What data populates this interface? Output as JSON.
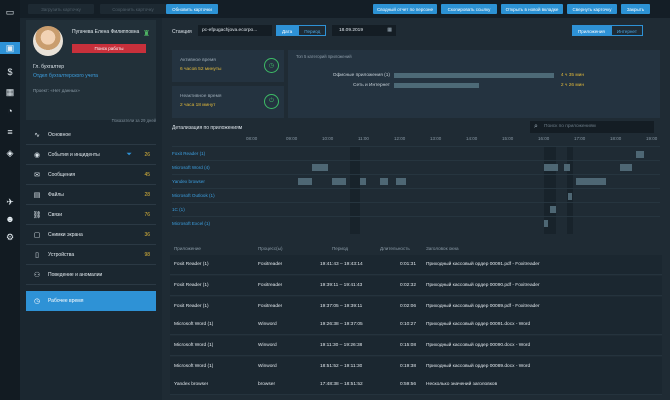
{
  "rail": {
    "icons": [
      "monitor-icon",
      "folder-icon",
      "dollar-icon",
      "calendar-icon",
      "chart-icon",
      "search-icon",
      "list-icon",
      "badge-icon",
      "airplane-icon",
      "person-icon",
      "filter-icon",
      "gear-icon"
    ]
  },
  "toolbar": {
    "ghost1": "Загрузить карточку",
    "ghost2": "Сохранить карточку",
    "update": "Обновить карточки",
    "summary_report": "Сводный отчет по персоне",
    "copy_link": "Скопировать ссылку",
    "open_new_tab": "Открыть в новой вкладке",
    "collapse_card": "Свернуть карточку",
    "close": "Закрыть"
  },
  "profile": {
    "name": "Пугачева Елена Филипповна",
    "search_button": "Поиск работы",
    "role": "Гл. бухгалтер",
    "department": "Отдел бухгалтерского учета",
    "project": "Проект: «Нет данных»",
    "period_label": "Показатели за 29 дней"
  },
  "menu": [
    {
      "label": "Основное",
      "count": ""
    },
    {
      "label": "События и инциденты",
      "count": "26"
    },
    {
      "label": "Сообщения",
      "count": "45"
    },
    {
      "label": "Файлы",
      "count": "28"
    },
    {
      "label": "Связи",
      "count": "76"
    },
    {
      "label": "Снимки экрана",
      "count": "36"
    },
    {
      "label": "Устройства",
      "count": "98"
    },
    {
      "label": "Поведение и аномалии",
      "count": ""
    },
    {
      "label": "Рабочее время",
      "count": ""
    }
  ],
  "main": {
    "station_label": "Станция",
    "station_value": "pc-efpugachjova.ecorpo...",
    "date_btn": "Дата",
    "period_btn": "Период",
    "date_value": "18.09.2019",
    "apps_btn": "Приложения",
    "internet_btn": "Интернет",
    "active_label": "Активное время",
    "active_value": "6 часов 52 минуты",
    "inactive_label": "Неактивное время",
    "inactive_value": "2 часа 18 минут",
    "categories_title": "Топ 5 категорий приложений",
    "categories": [
      {
        "label": "Офисные приложения (1)",
        "value": "4 ч 35 мин",
        "fraction": 1.0
      },
      {
        "label": "Сеть и Интернет",
        "value": "2 ч 26 мин",
        "fraction": 0.53
      }
    ],
    "detail_title": "Детализация по приложениям",
    "search_placeholder": "Поиск по приложениям"
  },
  "timeline": {
    "hours": [
      "08:00",
      "09:00",
      "10:00",
      "11:00",
      "12:00",
      "13:00",
      "14:00",
      "15:00",
      "16:00",
      "17:00",
      "18:00",
      "19:00"
    ],
    "apps": [
      "Foxit Reader (1)",
      "Microsoft Word (4)",
      "Yandex browser",
      "Microsoft Outlook (1)",
      "1C (1)",
      "Microsoft Excel (1)"
    ]
  },
  "table": {
    "headers": [
      "Приложение",
      "Процесс(ы)",
      "Период",
      "Длительность",
      "Заголовок окна"
    ],
    "rows": [
      [
        "Foxit Reader (1)",
        "Foxitreader",
        "19:41:43 – 19:43:14",
        "0:01:31",
        "Приходный кассовый ордер 00091.pdf - Foxitreader"
      ],
      [
        "Foxit Reader (1)",
        "Foxitreader",
        "19:39:11 – 19:41:43",
        "0:02:32",
        "Приходный кассовый ордер 00090.pdf - Foxitreader"
      ],
      [
        "Foxit Reader (1)",
        "Foxitreader",
        "19:37:05 – 19:39:11",
        "0:02:06",
        "Приходный кассовый ордер 00089.pdf - Foxitreader"
      ],
      [
        "Microsoft Word (1)",
        "Winword",
        "19:26:38 – 19:37:05",
        "0:10:27",
        "Приходный кассовый ордер 00091.docx - Word"
      ],
      [
        "Microsoft Word (1)",
        "Winword",
        "19:11:30 – 19:26:38",
        "0:15:08",
        "Приходный кассовый ордер 00090.docx - Word"
      ],
      [
        "Microsoft Word (1)",
        "Winword",
        "18:51:52 – 19:11:30",
        "0:19:38",
        "Приходный кассовый ордер 00089.docx - Word"
      ],
      [
        "Yandex browser",
        "browser",
        "17:48:38 – 18:51:52",
        "0:59:56",
        "Несколько значений заголовков"
      ]
    ]
  }
}
